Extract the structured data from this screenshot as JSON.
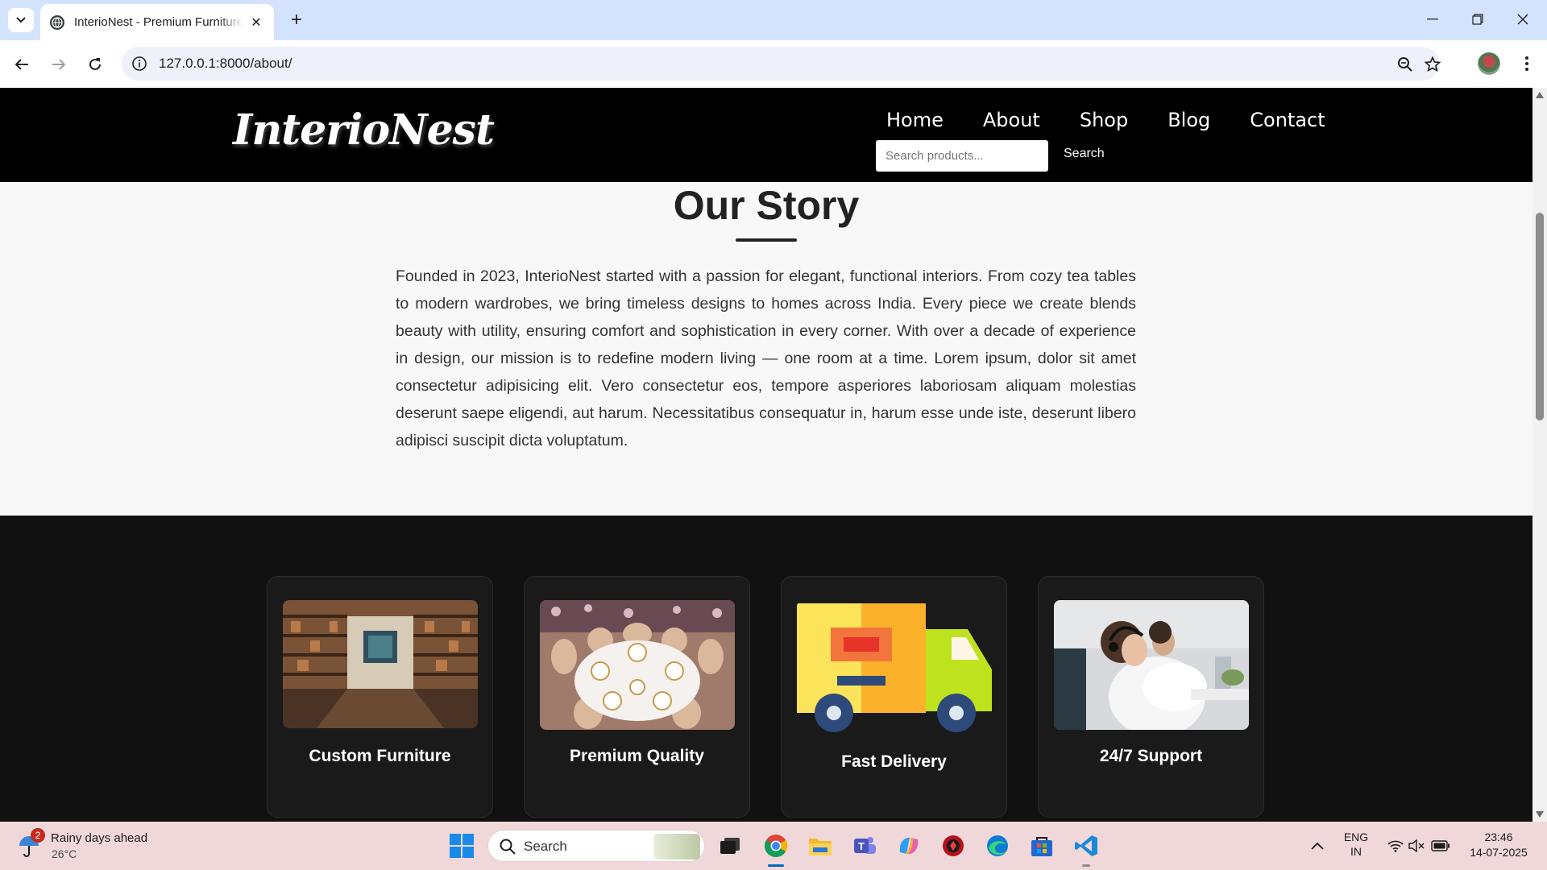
{
  "browser": {
    "tab_title": "InterioNest - Premium Furniture",
    "url": "127.0.0.1:8000/about/"
  },
  "site": {
    "logo": "InterioNest",
    "nav": [
      "Home",
      "About",
      "Shop",
      "Blog",
      "Contact"
    ],
    "search_placeholder": "Search products...",
    "search_button": "Search"
  },
  "story": {
    "heading": "Our Story",
    "body": "Founded in 2023, InterioNest started with a passion for elegant, functional interiors. From cozy tea tables to modern wardrobes, we bring timeless designs to homes across India. Every piece we create blends beauty with utility, ensuring comfort and sophistication in every corner. With over a decade of experience in design, our mission is to redefine modern living — one room at a time. Lorem ipsum, dolor sit amet consectetur adipisicing elit. Vero consectetur eos, tempore asperiores laboriosam aliquam molestias deserunt saepe eligendi, aut harum. Necessitatibus consequatur in, harum esse unde iste, deserunt libero adipisci suscipit dicta voluptatum."
  },
  "features": [
    {
      "label": "Custom Furniture",
      "image": "shelves-showroom-photo"
    },
    {
      "label": "Premium Quality",
      "image": "banquet-table-photo"
    },
    {
      "label": "Fast Delivery",
      "image": "delivery-truck-illustration"
    },
    {
      "label": "24/7 Support",
      "image": "call-center-agents-photo"
    }
  ],
  "taskbar": {
    "weather_badge": "2",
    "weather_title": "Rainy days ahead",
    "weather_temp": "26°C",
    "search_label": "Search",
    "lang_line1": "ENG",
    "lang_line2": "IN",
    "time": "23:46",
    "date": "14-07-2025"
  },
  "colors": {
    "tabbar": "#d3e3fd",
    "header": "#000000",
    "story_bg": "#f8f8f8",
    "features_bg": "#111111",
    "taskbar": "#f0d8da"
  }
}
